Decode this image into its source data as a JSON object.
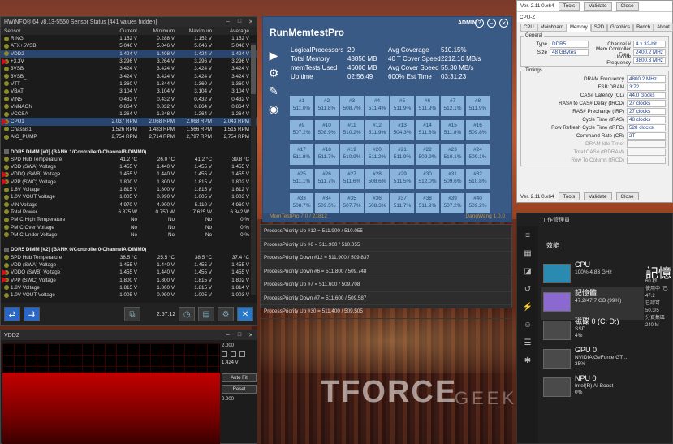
{
  "background": {
    "brand": "TFORCE",
    "sub": "GEEKNETIC"
  },
  "hwinfo": {
    "title": "HWiNFO® 64 v8.13-5550 Sensor Status [441 values hidden]",
    "columns": [
      "Sensor",
      "Current",
      "Minimum",
      "Maximum",
      "Average"
    ],
    "rows": [
      {
        "name": "RING",
        "cur": "1.152 V",
        "min": "0.288 V",
        "max": "1.152 V",
        "avg": "1.152 V"
      },
      {
        "name": "ATX+5VSB",
        "cur": "5.046 V",
        "min": "5.046 V",
        "max": "5.046 V",
        "avg": "5.046 V"
      },
      {
        "name": "VDD2",
        "cur": "1.424 V",
        "min": "1.408 V",
        "max": "1.424 V",
        "avg": "1.424 V",
        "selected": true
      },
      {
        "name": "+3.3V",
        "cur": "3.296 V",
        "min": "3.264 V",
        "max": "3.296 V",
        "avg": "3.296 V"
      },
      {
        "name": "3VSB",
        "cur": "3.424 V",
        "min": "3.424 V",
        "max": "3.424 V",
        "avg": "3.424 V"
      },
      {
        "name": "3VSB_",
        "cur": "3.424 V",
        "min": "3.424 V",
        "max": "3.424 V",
        "avg": "3.424 V"
      },
      {
        "name": "VTT",
        "cur": "1.360 V",
        "min": "1.344 V",
        "max": "1.360 V",
        "avg": "1.360 V"
      },
      {
        "name": "VBAT",
        "cur": "3.104 V",
        "min": "3.104 V",
        "max": "3.104 V",
        "avg": "3.104 V"
      },
      {
        "name": "VIN5",
        "cur": "0.432 V",
        "min": "0.432 V",
        "max": "0.432 V",
        "avg": "0.432 V"
      },
      {
        "name": "VNNAON",
        "cur": "0.864 V",
        "min": "0.832 V",
        "max": "0.864 V",
        "avg": "0.864 V"
      },
      {
        "name": "VCCSA",
        "cur": "1.264 V",
        "min": "1.248 V",
        "max": "1.264 V",
        "avg": "1.264 V"
      },
      {
        "name": "CPU1",
        "cur": "2,037 RPM",
        "min": "2,068 RPM",
        "max": "2,068 RPM",
        "avg": "2,043 RPM",
        "selected": true
      },
      {
        "name": "Chassis1",
        "cur": "1,526 RPM",
        "min": "1,483 RPM",
        "max": "1,566 RPM",
        "avg": "1,515 RPM"
      },
      {
        "name": "AIO_PUMP",
        "cur": "2,754 RPM",
        "min": "2,714 RPM",
        "max": "2,797 RPM",
        "avg": "2,754 RPM"
      },
      {
        "name": "",
        "cur": "",
        "min": "",
        "max": "",
        "avg": ""
      },
      {
        "name": "DDR5 DIMM [#0] (BANK 1/Controller0-ChannelB-DIMM0)",
        "group": true
      },
      {
        "name": "SPD Hub Temperature",
        "cur": "41.2 °C",
        "min": "26.0 °C",
        "max": "41.2 °C",
        "avg": "39.8 °C"
      },
      {
        "name": "VDD (SWA) Voltage",
        "cur": "1.455 V",
        "min": "1.440 V",
        "max": "1.455 V",
        "avg": "1.455 V"
      },
      {
        "name": "VDDQ (SWB) Voltage",
        "cur": "1.455 V",
        "min": "1.440 V",
        "max": "1.455 V",
        "avg": "1.455 V"
      },
      {
        "name": "VPP (SWC) Voltage",
        "cur": "1.800 V",
        "min": "1.800 V",
        "max": "1.815 V",
        "avg": "1.802 V"
      },
      {
        "name": "1.8V Voltage",
        "cur": "1.815 V",
        "min": "1.800 V",
        "max": "1.815 V",
        "avg": "1.812 V"
      },
      {
        "name": "1.0V VOUT Voltage",
        "cur": "1.005 V",
        "min": "0.990 V",
        "max": "1.005 V",
        "avg": "1.003 V"
      },
      {
        "name": "VIN Voltage",
        "cur": "4.970 V",
        "min": "4.900 V",
        "max": "5.110 V",
        "avg": "4.960 V"
      },
      {
        "name": "Total Power",
        "cur": "6.875 W",
        "min": "0.750 W",
        "max": "7.625 W",
        "avg": "6.842 W"
      },
      {
        "name": "PMIC High Temperature",
        "cur": "No",
        "min": "No",
        "max": "No",
        "avg": "0 %"
      },
      {
        "name": "PMIC Over Voltage",
        "cur": "No",
        "min": "No",
        "max": "No",
        "avg": "0 %"
      },
      {
        "name": "PMIC Under Voltage",
        "cur": "No",
        "min": "No",
        "max": "No",
        "avg": "0 %"
      },
      {
        "name": "",
        "cur": "",
        "min": "",
        "max": "",
        "avg": ""
      },
      {
        "name": "DDR5 DIMM [#2] (BANK 0/Controller0-ChannelA-DIMM0)",
        "group": true
      },
      {
        "name": "SPD Hub Temperature",
        "cur": "38.5 °C",
        "min": "25.5 °C",
        "max": "38.5 °C",
        "avg": "37.4 °C"
      },
      {
        "name": "VDD (SWA) Voltage",
        "cur": "1.455 V",
        "min": "1.440 V",
        "max": "1.455 V",
        "avg": "1.455 V"
      },
      {
        "name": "VDDQ (SWB) Voltage",
        "cur": "1.455 V",
        "min": "1.440 V",
        "max": "1.455 V",
        "avg": "1.455 V"
      },
      {
        "name": "VPP (SWC) Voltage",
        "cur": "1.800 V",
        "min": "1.800 V",
        "max": "1.815 V",
        "avg": "1.802 V"
      },
      {
        "name": "1.8V Voltage",
        "cur": "1.815 V",
        "min": "1.800 V",
        "max": "1.815 V",
        "avg": "1.814 V"
      },
      {
        "name": "1.0V VOUT Voltage",
        "cur": "1.005 V",
        "min": "0.990 V",
        "max": "1.005 V",
        "avg": "1.003 V"
      }
    ],
    "timer": "2:57:12"
  },
  "vdd2": {
    "title": "VDD2",
    "max": "2.000",
    "current": "1.424 V",
    "min": "0.000",
    "fill_fraction": 0.712,
    "autofit": "Auto Fit",
    "reset": "Reset"
  },
  "memtest": {
    "title": "RunMemtestPro",
    "admin": "ADMIN",
    "stats": [
      [
        "LogicalProcessors",
        "20",
        "Avg Coverage",
        "510.15%"
      ],
      [
        "Total Memory",
        "48850 MB",
        "40 T Cover Speed",
        "2212.10 MB/s"
      ],
      [
        "memTests Used",
        "46000 MB",
        "Avg Cover Speed",
        "55.30 MB/s"
      ],
      [
        "Up time",
        "02:56:49",
        "600% Est Time",
        "03:31:23"
      ]
    ],
    "cells": [
      [
        "#1",
        "511.0%"
      ],
      [
        "#2",
        "511.8%"
      ],
      [
        "#3",
        "508.7%"
      ],
      [
        "#4",
        "511.4%"
      ],
      [
        "#5",
        "511.9%"
      ],
      [
        "#6",
        "511.9%"
      ],
      [
        "#7",
        "512.1%"
      ],
      [
        "#8",
        "511.9%"
      ],
      [
        "#9",
        "507.2%"
      ],
      [
        "#10",
        "508.9%"
      ],
      [
        "#11",
        "510.2%"
      ],
      [
        "#12",
        "511.9%"
      ],
      [
        "#13",
        "504.3%"
      ],
      [
        "#14",
        "511.8%"
      ],
      [
        "#15",
        "511.8%"
      ],
      [
        "#16",
        "509.8%"
      ],
      [
        "#17",
        "511.8%"
      ],
      [
        "#18",
        "511.7%"
      ],
      [
        "#19",
        "510.9%"
      ],
      [
        "#20",
        "511.2%"
      ],
      [
        "#21",
        "511.9%"
      ],
      [
        "#22",
        "509.9%"
      ],
      [
        "#23",
        "510.1%"
      ],
      [
        "#24",
        "509.1%"
      ],
      [
        "#25",
        "511.1%"
      ],
      [
        "#26",
        "511.7%"
      ],
      [
        "#27",
        "511.6%"
      ],
      [
        "#28",
        "508.6%"
      ],
      [
        "#29",
        "511.5%"
      ],
      [
        "#30",
        "512.0%"
      ],
      [
        "#31",
        "509.6%"
      ],
      [
        "#32",
        "510.8%"
      ],
      [
        "#33",
        "508.7%"
      ],
      [
        "#34",
        "509.5%"
      ],
      [
        "#35",
        "507.7%"
      ],
      [
        "#36",
        "508.3%"
      ],
      [
        "#37",
        "511.7%"
      ],
      [
        "#38",
        "511.9%"
      ],
      [
        "#39",
        "507.2%"
      ],
      [
        "#40",
        "509.2%"
      ]
    ],
    "footer_left": "MemTestPro 7.0 / 21812",
    "footer_right": "DangWang 1.0.0"
  },
  "log": [
    "ProcessPriority Up #12 = 511.900 / 510.055",
    "ProcessPriority Up #6 = 511.900 / 510.055",
    "ProcessPriority Down #12 = 511.900 / 509.837",
    "ProcessPriority Down #6 = 511.800 / 509.748",
    "ProcessPriority Up #7 = 511.600 / 509.708",
    "ProcessPriority Down #7 = 511.600 / 509.587",
    "ProcessPriority Up #30 = 511.400 / 509.505"
  ],
  "cpuz_top": {
    "ver": "Ver. 2.11.0.x64",
    "tools": "Tools",
    "validate": "Validate",
    "close": "Close"
  },
  "cpuz": {
    "title": "CPU-Z",
    "tabs": [
      "CPU",
      "Mainboard",
      "Memory",
      "SPD",
      "Graphics",
      "Bench",
      "About"
    ],
    "general_label": "General",
    "type_k": "Type",
    "type_v": "DDR5",
    "size_k": "Size",
    "size_v": "48 GBytes",
    "channel_k": "Channel #",
    "channel_v": "4 x 32-bit",
    "mcf_k": "Mem Controller Freq.",
    "mcf_v": "2400.2 MHz",
    "uncore_k": "Uncore Frequency",
    "uncore_v": "3800.3 MHz",
    "timings_label": "Timings",
    "timings": [
      [
        "DRAM Frequency",
        "4800.2 MHz"
      ],
      [
        "FSB:DRAM",
        "3:72"
      ],
      [
        "CAS# Latency (CL)",
        "44.0 clocks"
      ],
      [
        "RAS# to CAS# Delay (tRCD)",
        "27 clocks"
      ],
      [
        "RAS# Precharge (tRP)",
        "27 clocks"
      ],
      [
        "Cycle Time (tRAS)",
        "48 clocks"
      ],
      [
        "Row Refresh Cycle Time (tRFC)",
        "528 clocks"
      ],
      [
        "Command Rate (CR)",
        "2T"
      ],
      [
        "DRAM Idle Timer",
        ""
      ],
      [
        "Total CAS# (tRDRAM)",
        ""
      ],
      [
        "Row To Column (tRCD)",
        ""
      ]
    ],
    "ver": "Ver. 2.11.0.x64",
    "tools": "Tools",
    "validate": "Validate",
    "close": "Close"
  },
  "taskmgr": {
    "title": "工作管理員",
    "heading": "效能",
    "items": [
      {
        "name": "CPU",
        "l1": "100% 4.83 GHz",
        "l2": ""
      },
      {
        "name": "記憶體",
        "l1": "47.2/47.7 GB (99%)",
        "l2": ""
      },
      {
        "name": "磁碟 0 (C: D:)",
        "l1": "SSD",
        "l2": "4%"
      },
      {
        "name": "GPU 0",
        "l1": "NVIDIA GeForce GT ...",
        "l2": "35%"
      },
      {
        "name": "NPU 0",
        "l1": "Intel(R) AI Boost",
        "l2": "0%"
      }
    ],
    "detail_title": "記憶",
    "detail_vals": [
      "60 秒",
      "使用中 (已",
      "47.2",
      "已認可",
      "50.3/5",
      "分頁集區",
      "240 M"
    ]
  }
}
